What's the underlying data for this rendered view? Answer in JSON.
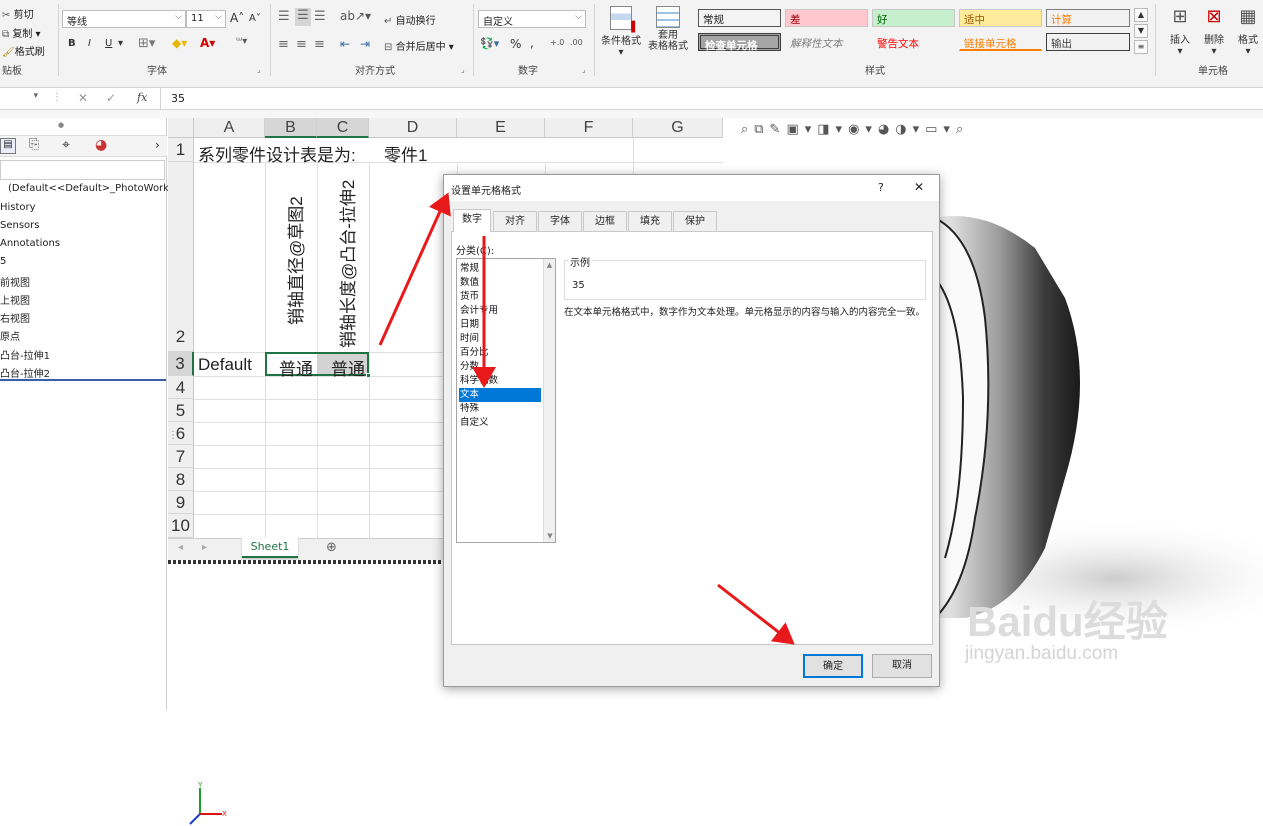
{
  "ribbon": {
    "clipboard": {
      "cut": "剪切",
      "copy": "复制",
      "format_painter": "格式刷",
      "group_label": "贴板"
    },
    "font": {
      "name": "等线",
      "size": "11",
      "group_label": "字体",
      "bold": "B",
      "italic": "I",
      "underline": "U",
      "grow": "A",
      "shrink": "A"
    },
    "alignment": {
      "wrap_text": "自动换行",
      "merge_center": "合并后居中",
      "group_label": "对齐方式"
    },
    "number": {
      "format": "自定义",
      "percent": "%",
      "comma": ",",
      "group_label": "数字"
    },
    "styles": {
      "conditional": "条件格式",
      "table_format": "套用\n表格格式",
      "cells": [
        {
          "label": "常规",
          "bg": "#ffffff",
          "fg": "#000000"
        },
        {
          "label": "差",
          "bg": "#ffc7ce",
          "fg": "#9c0006"
        },
        {
          "label": "好",
          "bg": "#c6efce",
          "fg": "#006100"
        },
        {
          "label": "适中",
          "bg": "#ffeb9c",
          "fg": "#9c5700"
        },
        {
          "label": "计算",
          "bg": "#f2f2f2",
          "fg": "#fa7d00"
        },
        {
          "label": "检查单元格",
          "bg": "#a5a5a5",
          "fg": "#ffffff"
        },
        {
          "label": "解释性文本",
          "bg": "#ffffff",
          "fg": "#7f7f7f"
        },
        {
          "label": "警告文本",
          "bg": "#ffffff",
          "fg": "#ff0000"
        },
        {
          "label": "链接单元格",
          "bg": "#ffffff",
          "fg": "#fa7d00"
        },
        {
          "label": "输出",
          "bg": "#f2f2f2",
          "fg": "#3f3f3f"
        }
      ],
      "group_label": "样式"
    },
    "cells_group": {
      "insert": "插入",
      "delete": "删除",
      "format": "格式",
      "group_label": "单元格"
    }
  },
  "formula_bar": {
    "fx": "fx",
    "value": "35"
  },
  "tree": {
    "items": [
      "(Default<<Default>_PhotoWorks",
      "History",
      "Sensors",
      "Annotations",
      "5",
      "前视图",
      "上视图",
      "右视图",
      "原点",
      "凸台-拉伸1",
      "凸台-拉伸2"
    ]
  },
  "sheet": {
    "columns": [
      "A",
      "B",
      "C",
      "D",
      "E",
      "F",
      "G"
    ],
    "rows": [
      "1",
      "2",
      "3",
      "4",
      "5",
      "6",
      "7",
      "8",
      "9",
      "10"
    ],
    "a1": "系列零件设计表是为:",
    "d1": "零件1",
    "b2": "销轴直径@草图2",
    "c2": "销轴长度@凸台-拉伸2",
    "a3": "Default",
    "b3": "普通",
    "c3": "普通",
    "tab": "Sheet1"
  },
  "dialog": {
    "title": "设置单元格格式",
    "help": "?",
    "close": "✕",
    "tabs": [
      "数字",
      "对齐",
      "字体",
      "边框",
      "填充",
      "保护"
    ],
    "category_label": "分类(C):",
    "categories": [
      "常规",
      "数值",
      "货币",
      "会计专用",
      "日期",
      "时间",
      "百分比",
      "分数",
      "科学记数",
      "文本",
      "特殊",
      "自定义"
    ],
    "selected_category": "文本",
    "sample_label": "示例",
    "sample_value": "35",
    "description": "在文本单元格格式中，数字作为文本处理。单元格显示的内容与输入的内容完全一致。",
    "ok": "确定",
    "cancel": "取消"
  },
  "watermark": {
    "brand": "Baidu经验",
    "url": "jingyan.baidu.com"
  },
  "colors": {
    "accent": "#0078d7",
    "arrow": "#e8191a",
    "excel_green": "#217346"
  }
}
